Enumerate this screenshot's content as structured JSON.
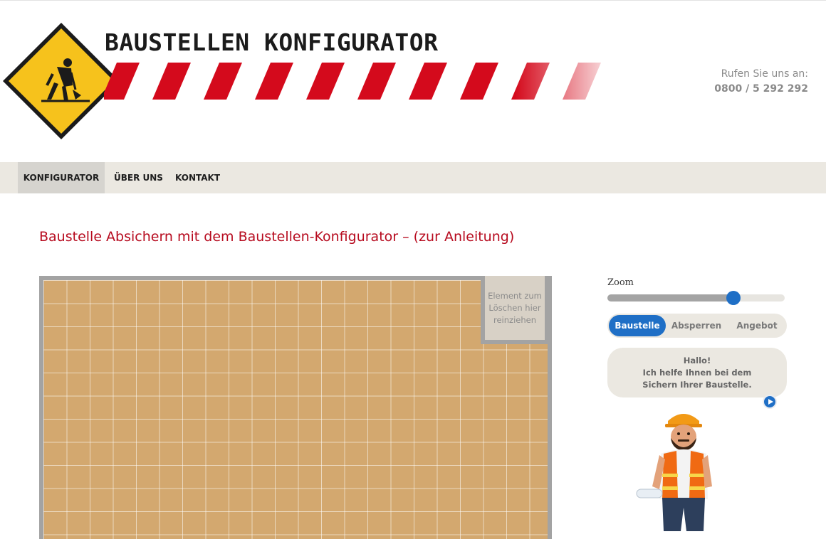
{
  "brand": {
    "title": "BAUSTELLEN KONFIGURATOR"
  },
  "contact": {
    "label": "Rufen Sie uns an:",
    "phone": "0800 / 5 292 292"
  },
  "nav": {
    "items": [
      {
        "label": "KONFIGURATOR",
        "active": true
      },
      {
        "label": "ÜBER UNS",
        "active": false
      },
      {
        "label": "KONTAKT",
        "active": false
      }
    ]
  },
  "page": {
    "title": "Baustelle Absichern mit dem Baustellen-Konfigurator – (zur Anleitung)"
  },
  "canvas": {
    "trash_lines": [
      "Element zum",
      "Löschen hier",
      "reinziehen"
    ]
  },
  "zoom": {
    "label": "Zoom",
    "value_fraction": 0.71
  },
  "tabs": [
    {
      "label": "Baustelle",
      "active": true
    },
    {
      "label": "Absperren",
      "active": false
    },
    {
      "label": "Angebot",
      "active": false
    }
  ],
  "assistant": {
    "lines": [
      "Hallo!",
      "Ich helfe Ihnen bei dem",
      "Sichern Ihrer Baustelle."
    ]
  },
  "colors": {
    "accent_blue": "#1f6fc6",
    "brand_red": "#b70b1f",
    "stripe_red": "#d40a1c",
    "sign_yellow": "#f6c21c",
    "grid_tan": "#d3a86f"
  }
}
